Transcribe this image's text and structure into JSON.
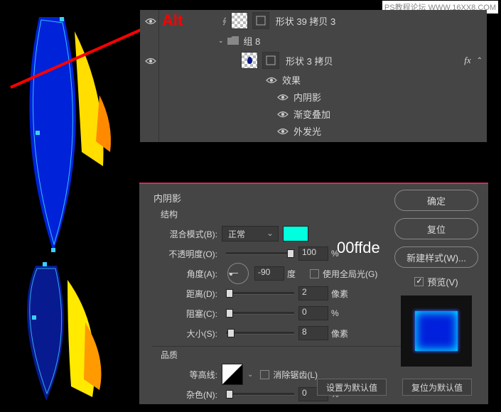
{
  "watermark": "PS教程论坛 WWW.16XX8.COM",
  "alt_label": "Alt",
  "layers": {
    "row1": {
      "label": "形状 39 拷贝 3"
    },
    "group": {
      "label": "组 8"
    },
    "row2": {
      "label": "形状 3 拷贝",
      "fx": "fx"
    },
    "effects_label": "效果",
    "fx1": "内阴影",
    "fx2": "渐变叠加",
    "fx3": "外发光"
  },
  "dialog": {
    "title": "内阴影",
    "structure": "结构",
    "blend_mode_label": "混合模式(B):",
    "blend_mode_value": "正常",
    "opacity_label": "不透明度(O):",
    "opacity_value": "100",
    "percent": "%",
    "angle_label": "角度(A):",
    "angle_value": "-90",
    "degrees": "度",
    "global_light": "使用全局光(G)",
    "distance_label": "距离(D):",
    "distance_value": "2",
    "px": "像素",
    "choke_label": "阻塞(C):",
    "choke_value": "0",
    "size_label": "大小(S):",
    "size_value": "8",
    "quality": "品质",
    "contour_label": "等高线:",
    "antialias": "消除锯齿(L)",
    "noise_label": "杂色(N):",
    "noise_value": "0",
    "btn_default": "设置为默认值",
    "btn_reset": "复位为默认值",
    "ok": "确定",
    "cancel": "复位",
    "new_style": "新建样式(W)...",
    "preview": "预览(V)",
    "color": "#00ffde"
  },
  "color_hex_text": "00ffde"
}
